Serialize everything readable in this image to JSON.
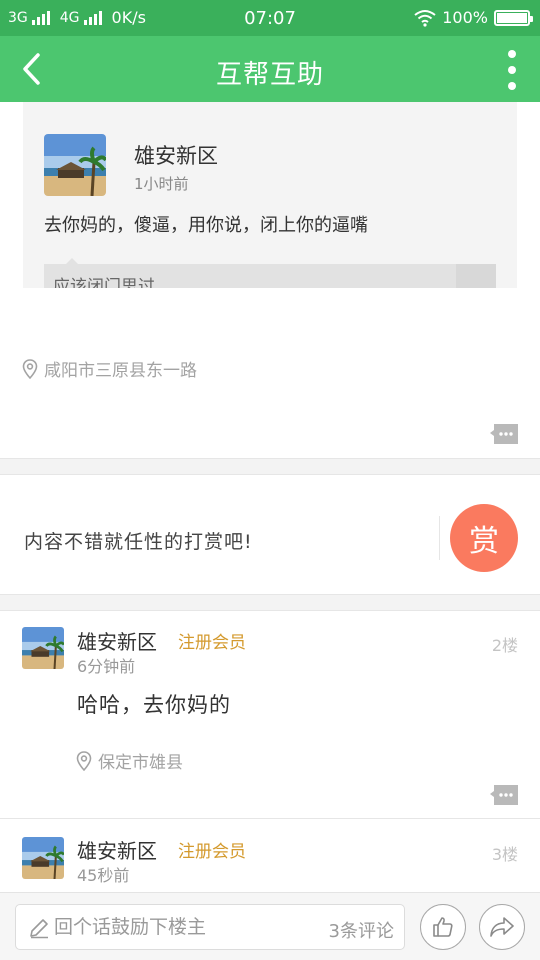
{
  "status_bar": {
    "signal_1": "3G",
    "signal_2": "4G",
    "net_speed": "0K/s",
    "time": "07:07",
    "battery": "100%"
  },
  "app_bar": {
    "title": "互帮互助"
  },
  "quoted_post": {
    "author": "雄安新区",
    "time": "1小时前",
    "text": "去你妈的，傻逼，用你说，闭上你的逼嘴",
    "reply_preview": "应该闭门思过"
  },
  "post": {
    "location": "咸阳市三原县东一路"
  },
  "reward": {
    "prompt": "内容不错就任性的打赏吧!",
    "button_label": "赏"
  },
  "comments": [
    {
      "author": "雄安新区",
      "badge": "注册会员",
      "time": "6分钟前",
      "floor": "2楼",
      "text": "哈哈，去你妈的",
      "location": "保定市雄县"
    },
    {
      "author": "雄安新区",
      "badge": "注册会员",
      "time": "45秒前",
      "floor": "3楼"
    }
  ],
  "bottom_bar": {
    "input_placeholder": "回个话鼓励下楼主",
    "comment_count": "3条评论"
  },
  "colors": {
    "status_bar": "#3ab05b",
    "app_bar": "#4cc66f",
    "reward_button": "#fa7a5f",
    "badge": "#d49a2e"
  }
}
